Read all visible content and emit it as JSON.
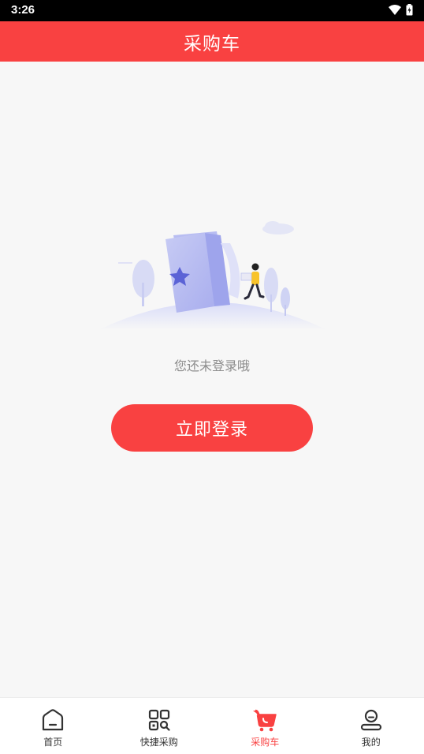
{
  "status_bar": {
    "time": "3:26",
    "icons": [
      "wifi-icon",
      "battery-icon"
    ]
  },
  "header": {
    "title": "采购车"
  },
  "main": {
    "empty_text": "您还未登录哦",
    "login_button": "立即登录"
  },
  "tabbar": {
    "items": [
      {
        "label": "首页",
        "icon": "home-icon",
        "active": false
      },
      {
        "label": "快捷采购",
        "icon": "quick-purchase-icon",
        "active": false
      },
      {
        "label": "采购车",
        "icon": "cart-icon",
        "active": true
      },
      {
        "label": "我的",
        "icon": "profile-icon",
        "active": false
      }
    ]
  },
  "colors": {
    "accent": "#f94141",
    "background": "#f7f7f7",
    "muted_text": "#8c8c8c"
  }
}
